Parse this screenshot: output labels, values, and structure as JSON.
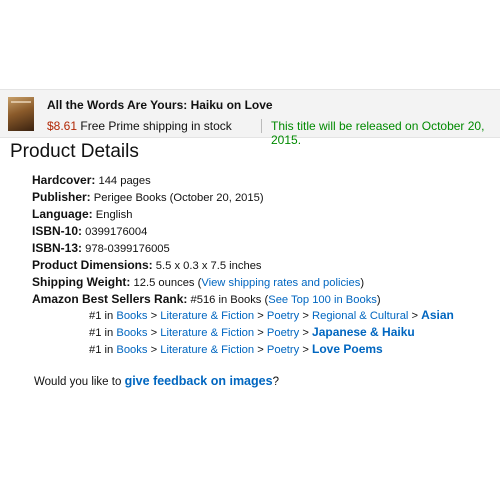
{
  "product": {
    "title": "All the Words Are Yours: Haiku on Love",
    "price": "$8.61",
    "shipping": "Free Prime shipping in stock",
    "release": "This title will be released on October 20, 2015."
  },
  "heading": "Product Details",
  "details": {
    "hardcover_label": "Hardcover:",
    "hardcover_value": "144 pages",
    "publisher_label": "Publisher:",
    "publisher_value": "Perigee Books (October 20, 2015)",
    "language_label": "Language:",
    "language_value": "English",
    "isbn10_label": "ISBN-10:",
    "isbn10_value": "0399176004",
    "isbn13_label": "ISBN-13:",
    "isbn13_value": "978-0399176005",
    "dimensions_label": "Product Dimensions:",
    "dimensions_value": "5.5 x 0.3 x 7.5 inches",
    "weight_label": "Shipping Weight:",
    "weight_value": "12.5 ounces (",
    "weight_link": "View shipping rates and policies",
    "weight_close": ")",
    "rank_label": "Amazon Best Sellers Rank:",
    "rank_value": "#516 in Books (",
    "rank_link": "See Top 100 in Books",
    "rank_close": ")"
  },
  "rankings": [
    {
      "rank": "#1 in",
      "path": [
        "Books",
        "Literature & Fiction",
        "Poetry",
        "Regional & Cultural"
      ],
      "leaf": "Asian"
    },
    {
      "rank": "#1 in",
      "path": [
        "Books",
        "Literature & Fiction",
        "Poetry"
      ],
      "leaf": "Japanese & Haiku"
    },
    {
      "rank": "#1 in",
      "path": [
        "Books",
        "Literature & Fiction",
        "Poetry"
      ],
      "leaf": "Love Poems"
    }
  ],
  "separator": ">",
  "feedback": {
    "prefix": "Would you like to",
    "link": "give feedback on images",
    "suffix": "?"
  },
  "colors": {
    "link": "#0066c0",
    "price": "#b12704",
    "release": "#008a00"
  }
}
